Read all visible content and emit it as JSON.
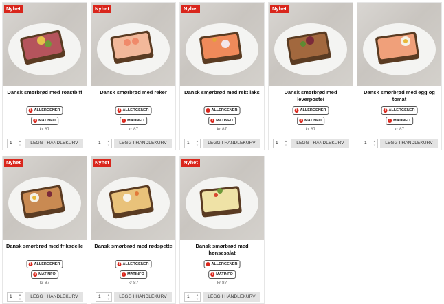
{
  "badge_label": "Nyhet",
  "allergens_label": "ALLERGENER",
  "matinfo_label": "MATINFO",
  "cart_button_label": "LEGG I HANDLEKURV",
  "products": [
    {
      "name": "Dansk smørbrød med roastbiff",
      "price": "kr 87",
      "qty": "1"
    },
    {
      "name": "Dansk smørbrød med reker",
      "price": "kr 87",
      "qty": "1"
    },
    {
      "name": "Dansk smørbrød med rekt laks",
      "price": "kr 87",
      "qty": "1"
    },
    {
      "name": "Dansk smørbrød med leverpostei",
      "price": "kr 87",
      "qty": "1"
    },
    {
      "name": "Dansk smørbrød med egg og tomat",
      "price": "kr 87",
      "qty": "1"
    },
    {
      "name": "Dansk smørbrød med frikadelle",
      "price": "kr 87",
      "qty": "1"
    },
    {
      "name": "Dansk smørbrød med rødspette",
      "price": "kr 87",
      "qty": "1"
    },
    {
      "name": "Dansk smørbrød med hønsesalat",
      "price": "kr 87",
      "qty": "1"
    }
  ],
  "colors": {
    "badge": "#d9261c",
    "cart_button": "#e3e3e3"
  },
  "icons": {
    "allergens": "exclamation-icon",
    "matinfo": "info-icon"
  }
}
